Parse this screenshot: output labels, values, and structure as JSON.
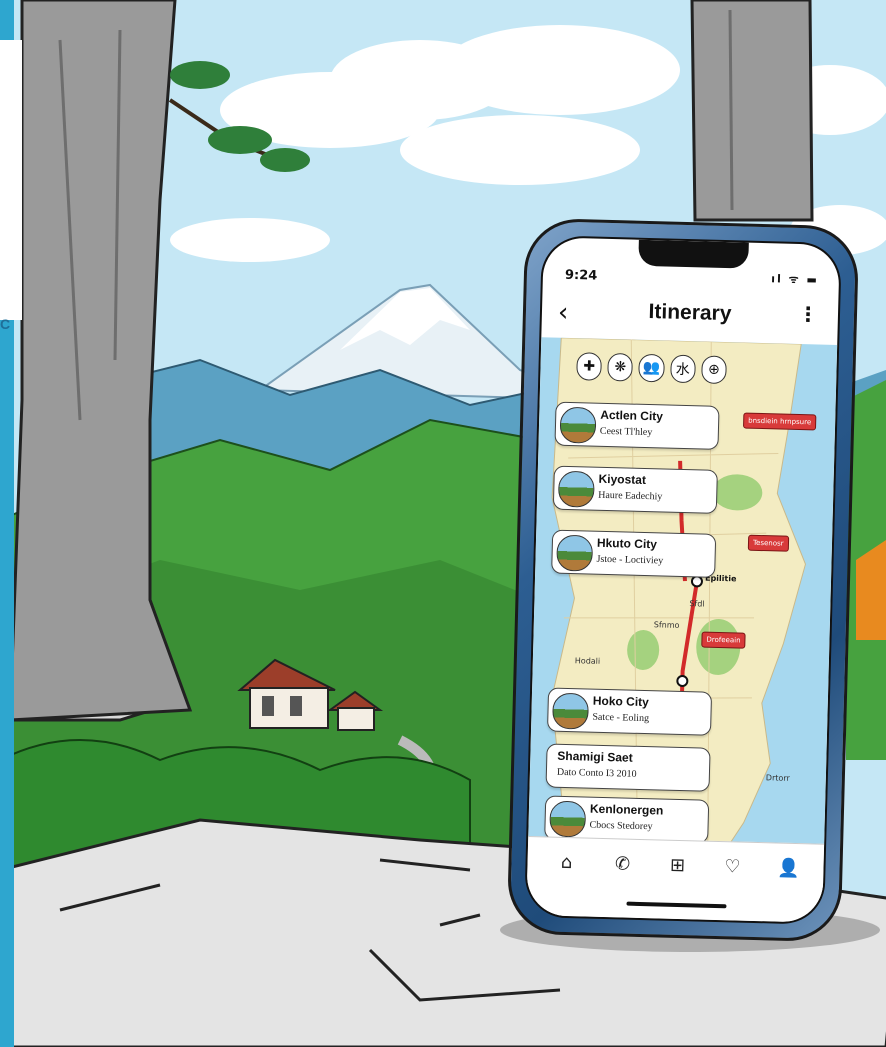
{
  "scene": {
    "description_icons": [
      "tree-icon",
      "mountain-icon",
      "house-icon",
      "rock-icon"
    ],
    "colors": {
      "sky": "#bfe3f3",
      "forest": "#3f9a3a",
      "mountain": "#6aa7c7",
      "rock": "#d7d7d7",
      "border_left": "#2ea6cf"
    },
    "side_text": "C"
  },
  "phone": {
    "status": {
      "time": "9:24",
      "icons": "ıl ᯤ ▬"
    },
    "header": {
      "back_icon": "‹",
      "title": "Itinerary",
      "more_icon": "⋮"
    },
    "categories": [
      "✚",
      "❋",
      "👥",
      "⽔",
      "⊕"
    ],
    "cards": [
      {
        "name": "Actlen City",
        "sub": "Ceest Tl'hley"
      },
      {
        "name": "Kiyostat",
        "sub": "Haure Eadechiy"
      },
      {
        "name": "Hkuto City",
        "sub": "Jstoe - Loctiviey"
      },
      {
        "name": "Hoko City",
        "sub": "Satce - Eoling"
      },
      {
        "name": "Shamigi Saet",
        "sub": "Dato Conto I3 2010"
      },
      {
        "name": "Kenlonergen",
        "sub": "Cbocs Stedorey"
      }
    ],
    "map_labels": {
      "pin1": "bnsdiein hrnpsure",
      "pin2": "Tesenosr",
      "pin3": "Drofeeain",
      "stop": "Epilitie",
      "city_left": "Hodali",
      "small1": "Drtorr",
      "small2": "Sfdl",
      "small3": "Sfnmo"
    },
    "tabs": [
      "⌂",
      "✆",
      "⊞",
      "♡",
      "👤"
    ],
    "colors": {
      "route": "#d22a2a",
      "water": "#a7d8ef",
      "land": "#f3ecc2",
      "frame": "#2d5e92"
    }
  }
}
